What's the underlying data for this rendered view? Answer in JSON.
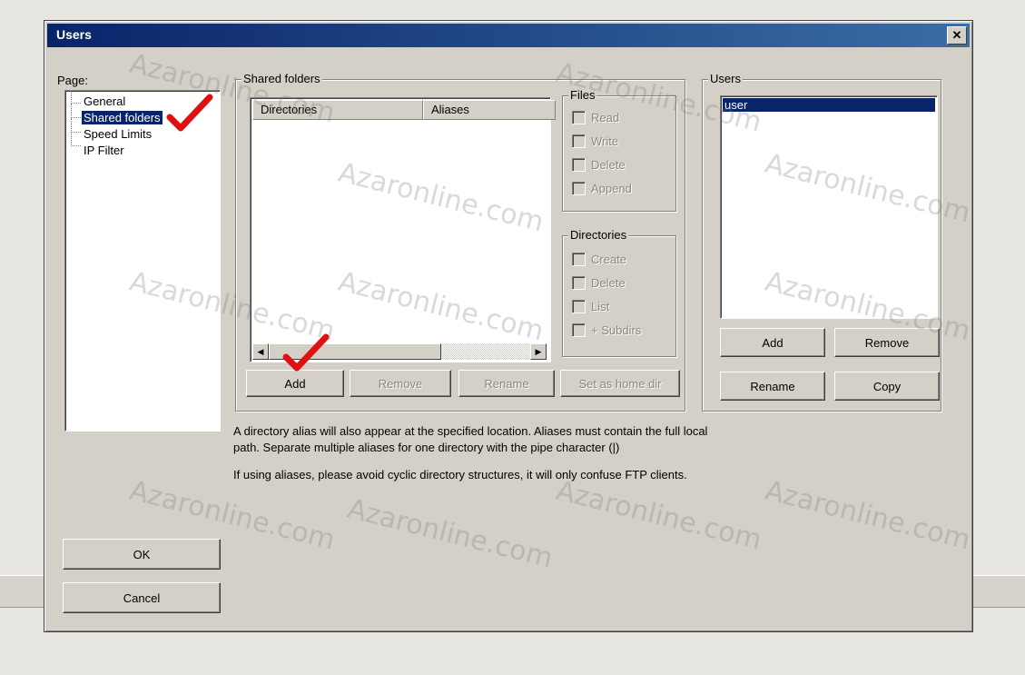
{
  "window": {
    "title": "Users",
    "close_glyph": "✕"
  },
  "page_panel": {
    "label": "Page:",
    "items": [
      "General",
      "Shared folders",
      "Speed Limits",
      "IP Filter"
    ],
    "selected_index": 1
  },
  "shared_folders": {
    "group_title": "Shared folders",
    "columns": [
      "Directories",
      "Aliases"
    ],
    "rows": [],
    "buttons": {
      "add": "Add",
      "remove": "Remove",
      "rename": "Rename",
      "set_home": "Set as home dir"
    }
  },
  "files_group": {
    "title": "Files",
    "options": [
      "Read",
      "Write",
      "Delete",
      "Append"
    ]
  },
  "directories_group": {
    "title": "Directories",
    "options": [
      "Create",
      "Delete",
      "List",
      "+ Subdirs"
    ]
  },
  "users_panel": {
    "title": "Users",
    "items": [
      "user"
    ],
    "selected_index": 0,
    "buttons": {
      "add": "Add",
      "remove": "Remove",
      "rename": "Rename",
      "copy": "Copy"
    }
  },
  "info": {
    "line1": "A directory alias will also appear at the specified location. Aliases must contain the full local",
    "line2": "path. Separate multiple aliases for one directory with the pipe character (|)",
    "line3": "If using aliases, please avoid cyclic directory structures, it will only confuse FTP clients."
  },
  "dialog_buttons": {
    "ok": "OK",
    "cancel": "Cancel"
  },
  "watermark": "Azaronline.com",
  "annotation_color": "#e01010"
}
